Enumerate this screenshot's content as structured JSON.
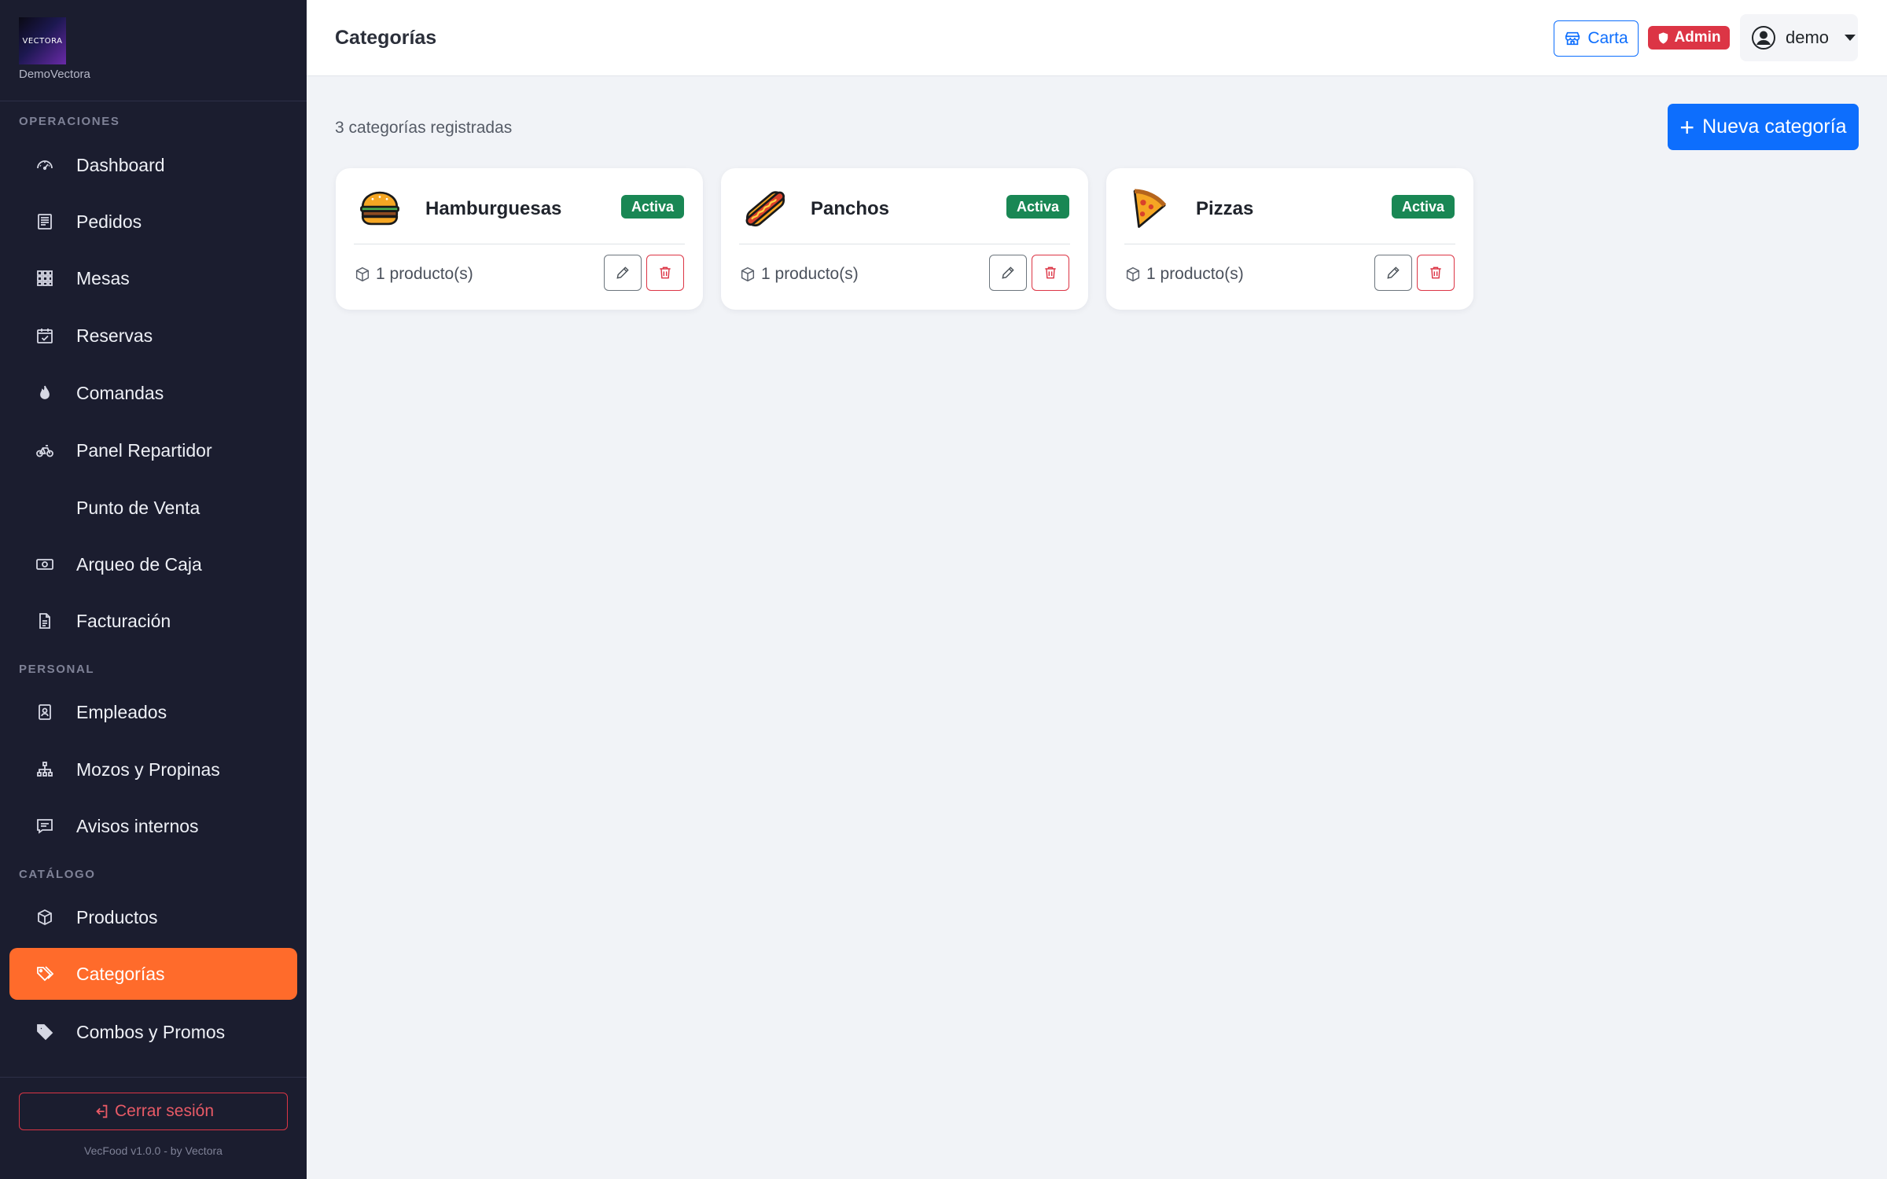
{
  "brand": {
    "logo_text": "VECTORA",
    "name": "DemoVectora"
  },
  "sidebar": {
    "sections": [
      {
        "label": "OPERACIONES"
      },
      {
        "label": "PERSONAL"
      },
      {
        "label": "CATÁLOGO"
      }
    ],
    "items": [
      {
        "label": "Dashboard",
        "icon": "speedometer-icon"
      },
      {
        "label": "Pedidos",
        "icon": "receipt-icon"
      },
      {
        "label": "Mesas",
        "icon": "grid-icon"
      },
      {
        "label": "Reservas",
        "icon": "calendar-check-icon"
      },
      {
        "label": "Comandas",
        "icon": "fire-icon"
      },
      {
        "label": "Panel Repartidor",
        "icon": "bicycle-icon"
      },
      {
        "label": "Punto de Venta",
        "icon": ""
      },
      {
        "label": "Arqueo de Caja",
        "icon": "cash-icon"
      },
      {
        "label": "Facturación",
        "icon": "document-icon"
      },
      {
        "label": "Empleados",
        "icon": "id-badge-icon"
      },
      {
        "label": "Mozos y Propinas",
        "icon": "diagram-icon"
      },
      {
        "label": "Avisos internos",
        "icon": "chat-icon"
      },
      {
        "label": "Productos",
        "icon": "box-icon"
      },
      {
        "label": "Categorías",
        "icon": "tags-icon",
        "active": true
      },
      {
        "label": "Combos y Promos",
        "icon": "tag-icon"
      }
    ],
    "logout_label": "Cerrar sesión",
    "version": "VecFood v1.0.0 - by Vectora"
  },
  "header": {
    "title": "Categorías",
    "carta_label": "Carta",
    "admin_label": "Admin",
    "user_name": "demo"
  },
  "main": {
    "count_text": "3 categorías registradas",
    "new_button_label": "Nueva categoría",
    "new_button_plus": "+",
    "categories": [
      {
        "name": "Hamburguesas",
        "status": "Activa",
        "products": "1 producto(s)",
        "icon": "burger-icon"
      },
      {
        "name": "Panchos",
        "status": "Activa",
        "products": "1 producto(s)",
        "icon": "hotdog-icon"
      },
      {
        "name": "Pizzas",
        "status": "Activa",
        "products": "1 producto(s)",
        "icon": "pizza-icon"
      }
    ]
  },
  "colors": {
    "sidebar_bg": "#1b1d2f",
    "active_item": "#ff6b2b",
    "primary": "#0d6efd",
    "danger": "#dc3545",
    "success": "#198754"
  }
}
